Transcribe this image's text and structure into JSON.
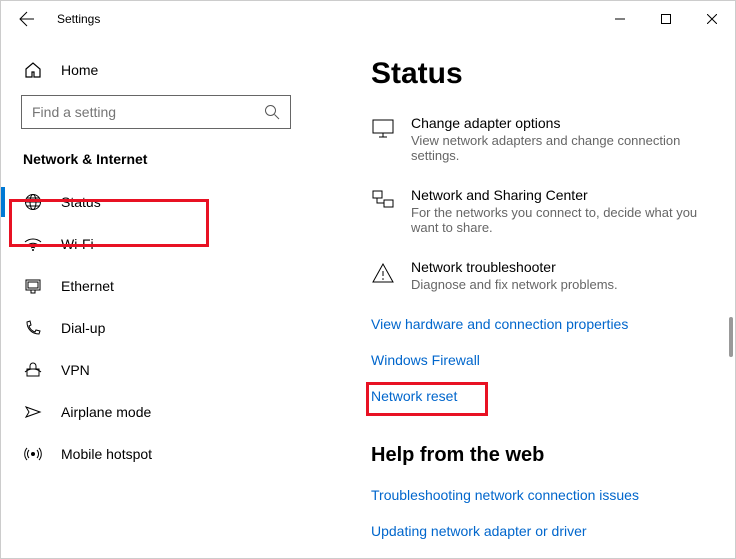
{
  "titlebar": {
    "title": "Settings"
  },
  "sidebar": {
    "home": "Home",
    "search_placeholder": "Find a setting",
    "section": "Network & Internet",
    "items": [
      {
        "label": "Status"
      },
      {
        "label": "Wi-Fi"
      },
      {
        "label": "Ethernet"
      },
      {
        "label": "Dial-up"
      },
      {
        "label": "VPN"
      },
      {
        "label": "Airplane mode"
      },
      {
        "label": "Mobile hotspot"
      }
    ]
  },
  "main": {
    "heading": "Status",
    "options": [
      {
        "title": "Change adapter options",
        "desc": "View network adapters and change connection settings."
      },
      {
        "title": "Network and Sharing Center",
        "desc": "For the networks you connect to, decide what you want to share."
      },
      {
        "title": "Network troubleshooter",
        "desc": "Diagnose and fix network problems."
      }
    ],
    "links": [
      "View hardware and connection properties",
      "Windows Firewall",
      "Network reset"
    ],
    "help_heading": "Help from the web",
    "help_links": [
      "Troubleshooting network connection issues",
      "Updating network adapter or driver"
    ]
  }
}
